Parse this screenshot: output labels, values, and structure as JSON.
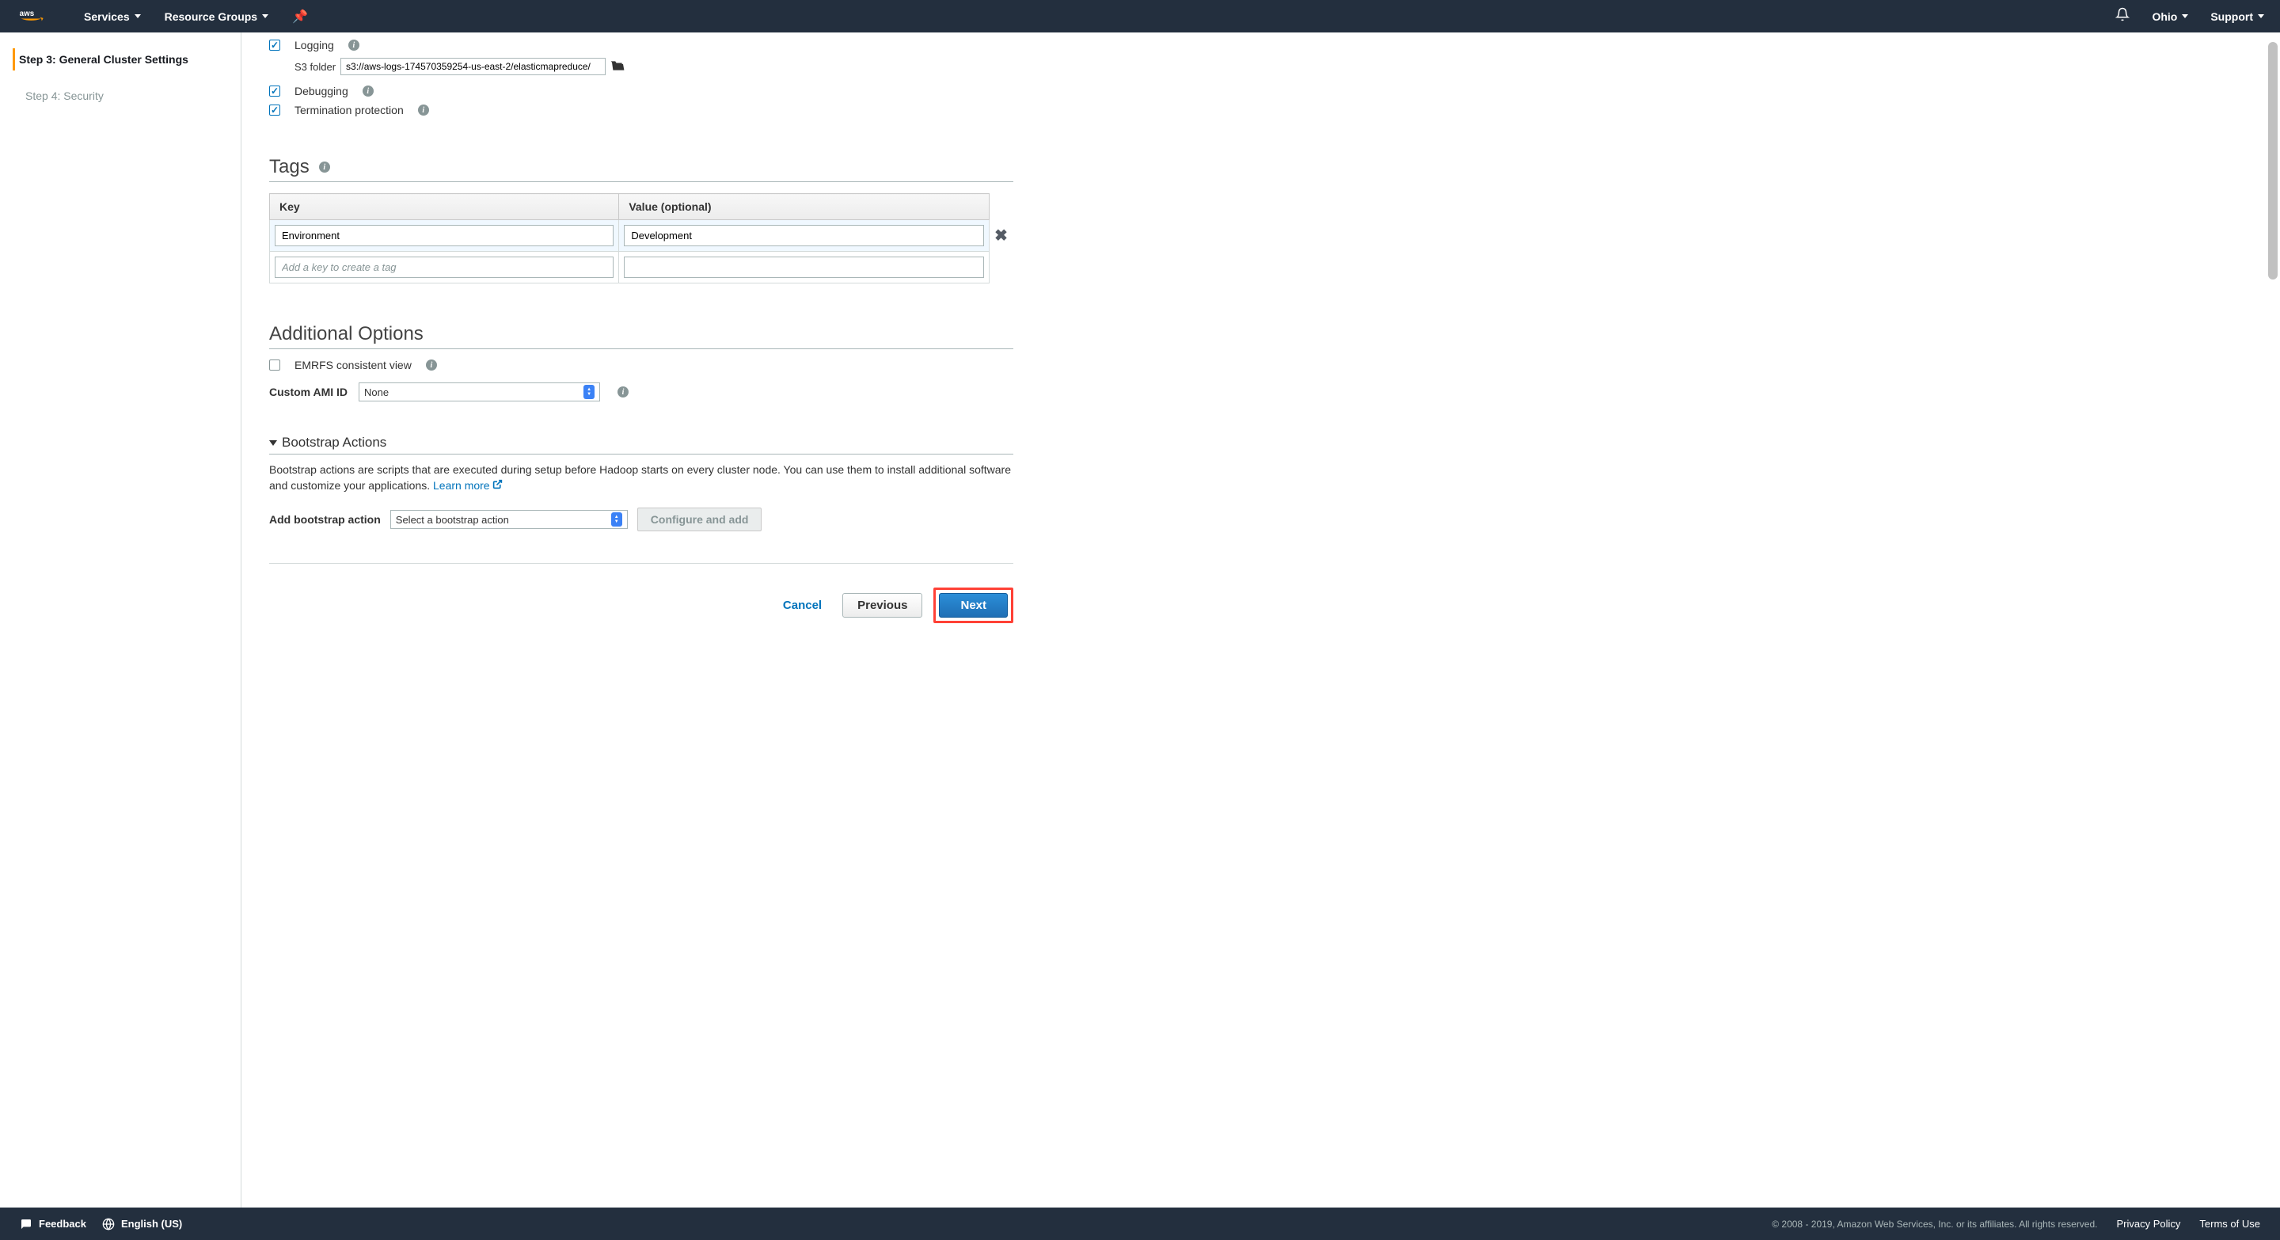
{
  "nav": {
    "services": "Services",
    "resource_groups": "Resource Groups",
    "region": "Ohio",
    "support": "Support"
  },
  "sidebar": {
    "steps": [
      {
        "label": "Step 3: General Cluster Settings",
        "active": true
      },
      {
        "label": "Step 4: Security",
        "active": false
      }
    ]
  },
  "general": {
    "logging_label": "Logging",
    "s3_label": "S3 folder",
    "s3_value": "s3://aws-logs-174570359254-us-east-2/elasticmapreduce/",
    "debugging_label": "Debugging",
    "termination_label": "Termination protection"
  },
  "tags": {
    "heading": "Tags",
    "key_header": "Key",
    "value_header": "Value (optional)",
    "row": {
      "key": "Environment",
      "value": "Development"
    },
    "new_placeholder": "Add a key to create a tag"
  },
  "additional": {
    "heading": "Additional Options",
    "emrfs_label": "EMRFS consistent view",
    "ami_label": "Custom AMI ID",
    "ami_value": "None"
  },
  "bootstrap": {
    "heading": "Bootstrap Actions",
    "description": "Bootstrap actions are scripts that are executed during setup before Hadoop starts on every cluster node. You can use them to install additional software and customize your applications. ",
    "learn_more": "Learn more",
    "add_label": "Add bootstrap action",
    "add_select": "Select a bootstrap action",
    "configure_btn": "Configure and add"
  },
  "buttons": {
    "cancel": "Cancel",
    "previous": "Previous",
    "next": "Next"
  },
  "footer": {
    "feedback": "Feedback",
    "language": "English (US)",
    "copyright": "© 2008 - 2019, Amazon Web Services, Inc. or its affiliates. All rights reserved.",
    "privacy": "Privacy Policy",
    "terms": "Terms of Use"
  }
}
